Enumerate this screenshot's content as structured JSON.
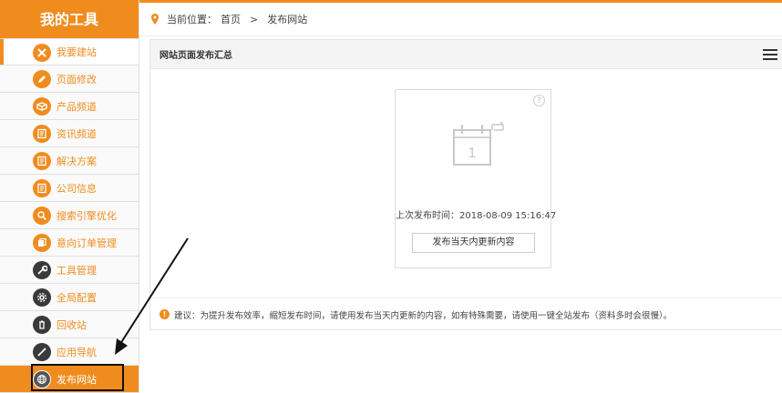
{
  "sidebar": {
    "title": "我的工具",
    "items": [
      {
        "label": "我要建站"
      },
      {
        "label": "页面修改"
      },
      {
        "label": "产品频道"
      },
      {
        "label": "资讯频道"
      },
      {
        "label": "解决方案"
      },
      {
        "label": "公司信息"
      },
      {
        "label": "搜索引擎优化"
      },
      {
        "label": "意向订单管理"
      },
      {
        "label": "工具管理"
      },
      {
        "label": "全局配置"
      },
      {
        "label": "回收站"
      },
      {
        "label": "应用导航"
      },
      {
        "label": "发布网站"
      }
    ]
  },
  "breadcrumb": {
    "prefix": "当前位置：",
    "home": "首页",
    "separator": ">",
    "current": "发布网站"
  },
  "panel": {
    "title": "网站页面发布汇总",
    "card": {
      "help": "?",
      "calendar_day": "1",
      "last_publish": "上次发布时间：2018-08-09 15:16:47",
      "publish_button": "发布当天内更新内容"
    },
    "tip": "建议：为提升发布效率，缩短发布时间，请使用发布当天内更新的内容，如有特殊需要，请使用一键全站发布（资料多时会很慢）。",
    "tip_icon": "!"
  },
  "colors": {
    "accent": "#f08c1e",
    "annotation": "#111111"
  }
}
